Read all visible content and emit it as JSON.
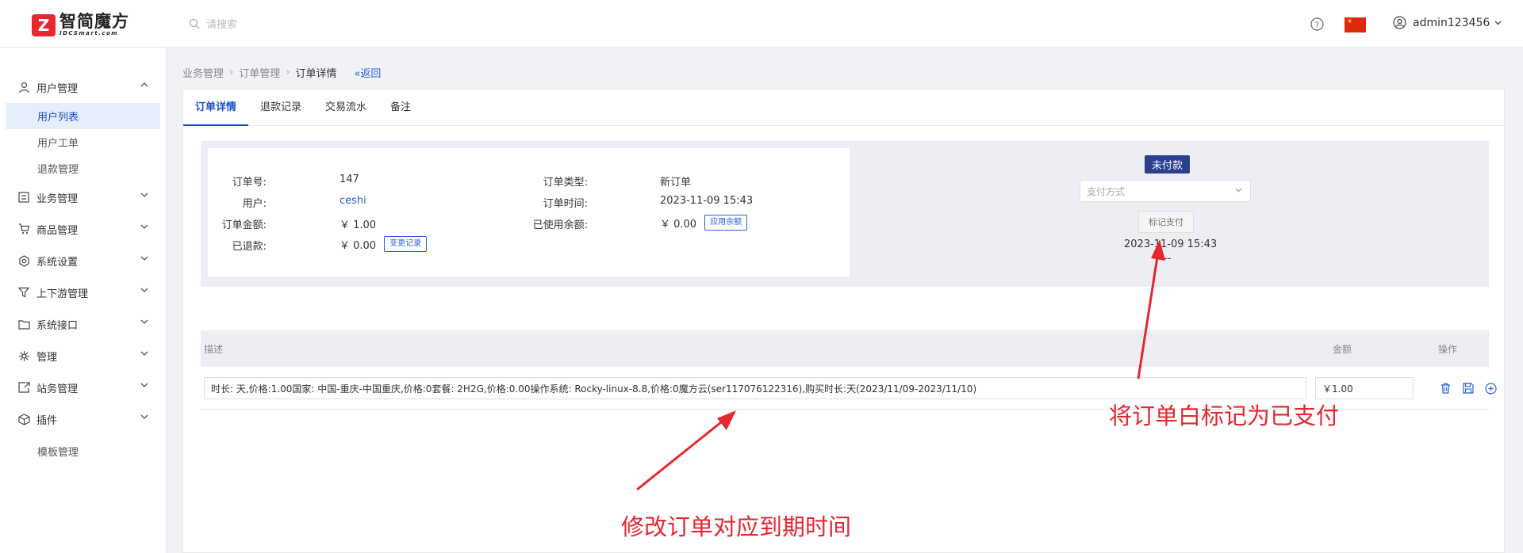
{
  "header": {
    "logo_main": "智简魔方",
    "logo_sub": "IDCSmart.com",
    "search_placeholder": "请搜索",
    "username": "admin123456"
  },
  "sidebar": {
    "items": [
      {
        "label": "用户管理",
        "icon": "user-icon",
        "expanded": true
      },
      {
        "label": "业务管理",
        "icon": "list-icon"
      },
      {
        "label": "商品管理",
        "icon": "cart-icon"
      },
      {
        "label": "系统设置",
        "icon": "gear-icon"
      },
      {
        "label": "上下游管理",
        "icon": "filter-icon"
      },
      {
        "label": "系统接口",
        "icon": "folder-icon"
      },
      {
        "label": "管理",
        "icon": "sun-icon"
      },
      {
        "label": "站务管理",
        "icon": "share-icon"
      },
      {
        "label": "插件",
        "icon": "cube-icon"
      }
    ],
    "subitems": [
      "用户列表",
      "用户工单",
      "退款管理"
    ],
    "template_item": "模板管理"
  },
  "breadcrumb": {
    "items": [
      "业务管理",
      "订单管理",
      "订单详情"
    ],
    "back": "«返回"
  },
  "tabs": [
    "订单详情",
    "退款记录",
    "交易流水",
    "备注"
  ],
  "order": {
    "labels": {
      "order_no": "订单号:",
      "user": "用户:",
      "amount": "订单金额:",
      "refunded": "已退款:",
      "type": "订单类型:",
      "time": "订单时间:",
      "balance_used": "已使用余额:"
    },
    "order_no": "147",
    "user": "ceshi",
    "amount": "￥ 1.00",
    "refunded": "￥ 0.00",
    "change_log_btn": "变更记录",
    "type": "新订单",
    "time": "2023-11-09 15:43",
    "balance_used": "￥ 0.00",
    "apply_balance_btn": "应用余额"
  },
  "payment": {
    "status": "未付款",
    "status_color": "#2b3f8e",
    "method_placeholder": "支付方式",
    "mark_paid_btn": "标记支付",
    "time": "2023-11-09 15:43",
    "dash": "--"
  },
  "table": {
    "headers": {
      "desc": "描述",
      "amount": "金额",
      "ops": "操作"
    },
    "rows": [
      {
        "desc": "时长: 天,价格:1.00国家: 中国-重庆-中国重庆,价格:0套餐: 2H2G,价格:0.00操作系统: Rocky-linux-8.8,价格:0魔方云(ser117076122316),购买时长:天(2023/11/09-2023/11/10)",
        "amount": "￥1.00"
      }
    ]
  },
  "annotations": {
    "mark_paid": "将订单白标记为已支付",
    "modify_expiry": "修改订单对应到期时间",
    "color": "#e8262f"
  }
}
